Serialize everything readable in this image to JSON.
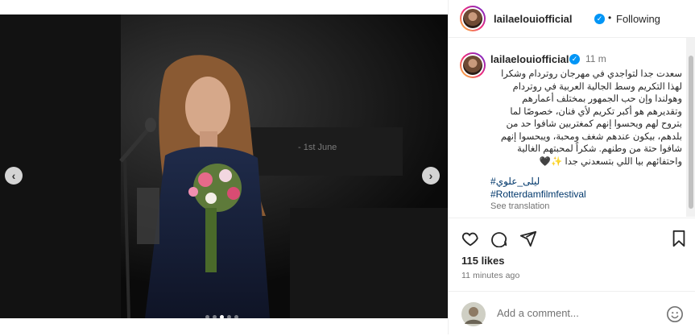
{
  "post": {
    "carousel": {
      "total_slides": 5,
      "active_slide": 3
    }
  },
  "panel": {
    "username": "lailaelouiofficial",
    "separator": "•",
    "follow_status": "Following",
    "caption": {
      "username": "lailaelouiofficial",
      "time": "11 m",
      "text": "سعدت جدا لتواجدي في مهرجان روتردام وشكرا لهذا التكريم وسط الجالية العربية في روتردام وهولندا وإن حب الجمهور بمختلف أعمارهم وتقديرهم هو أكبر تكريم لأي فنان، خصوصًا لما بتروح لهم ويحسوا إنهم كمغتربين شافوا حد من بلدهم، بيكون عندهم شغف ومحبة، ويبحسوا إنهم شافوا حتة من وطنهم. شكراً لمحبتهم الغالية واحتفائهم بيا اللي بتسعدني جدا ✨🖤",
      "tag1": "#ليلى_علوي",
      "tag2": "#Rotterdamfilmfestival",
      "see_translation": "See translation"
    },
    "likes": "115 likes",
    "timestamp": "11 minutes ago",
    "comment_placeholder": "Add a comment..."
  },
  "icons": [
    "chevron-left-icon",
    "chevron-right-icon",
    "verified-badge-icon",
    "more-icon",
    "heart-icon",
    "comment-icon",
    "share-icon",
    "bookmark-icon",
    "emoji-icon"
  ],
  "colors": {
    "verified": "#0095f6",
    "hashtag": "#00376b",
    "muted": "#737373",
    "text": "#262626"
  }
}
